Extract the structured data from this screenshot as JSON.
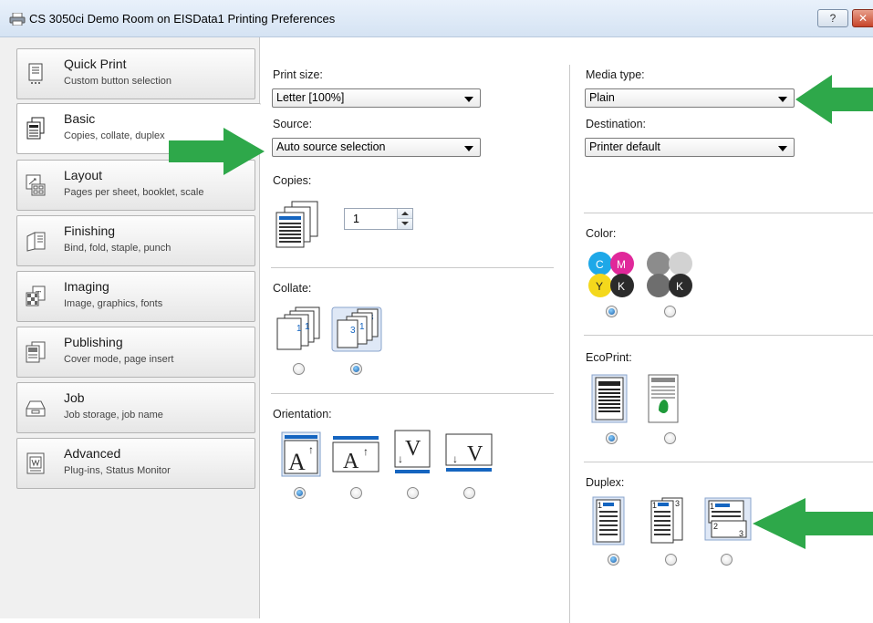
{
  "window": {
    "title": "CS 3050ci Demo Room on EISData1 Printing Preferences",
    "help_label": "?",
    "close_label": "✕"
  },
  "sidebar": {
    "items": [
      {
        "label": "Quick Print",
        "desc": "Custom button selection",
        "icon": "quick-print-icon"
      },
      {
        "label": "Basic",
        "desc": "Copies, collate, duplex",
        "icon": "basic-icon"
      },
      {
        "label": "Layout",
        "desc": "Pages per sheet, booklet, scale",
        "icon": "layout-icon"
      },
      {
        "label": "Finishing",
        "desc": "Bind, fold, staple, punch",
        "icon": "finishing-icon"
      },
      {
        "label": "Imaging",
        "desc": "Image, graphics, fonts",
        "icon": "imaging-icon"
      },
      {
        "label": "Publishing",
        "desc": "Cover mode, page insert",
        "icon": "publishing-icon"
      },
      {
        "label": "Job",
        "desc": "Job storage, job name",
        "icon": "job-icon"
      },
      {
        "label": "Advanced",
        "desc": "Plug-ins, Status Monitor",
        "icon": "advanced-icon"
      }
    ],
    "active_index": 1
  },
  "main": {
    "print_size": {
      "label": "Print size:",
      "value": "Letter  [100%]"
    },
    "source": {
      "label": "Source:",
      "value": "Auto source selection"
    },
    "copies": {
      "label": "Copies:",
      "value": "1"
    },
    "collate": {
      "label": "Collate:",
      "options": [
        "uncollated",
        "collated"
      ],
      "selected": 1
    },
    "orientation": {
      "label": "Orientation:",
      "options": [
        "portrait",
        "landscape",
        "rotated-portrait",
        "rotated-landscape"
      ],
      "selected": 0
    },
    "media_type": {
      "label": "Media type:",
      "value": "Plain"
    },
    "destination": {
      "label": "Destination:",
      "value": "Printer default"
    },
    "color": {
      "label": "Color:",
      "options": [
        "color",
        "black-and-white"
      ],
      "selected": 0,
      "cmyk_letters": [
        "C",
        "M",
        "Y",
        "K"
      ],
      "bw_letter": "K"
    },
    "ecoprint": {
      "label": "EcoPrint:",
      "options": [
        "off",
        "on"
      ],
      "selected": 0
    },
    "duplex": {
      "label": "Duplex:",
      "options": [
        "1-sided",
        "2-sided-long-edge",
        "2-sided-short-edge"
      ],
      "selected": 0
    }
  },
  "colors": {
    "accent_blue": "#1565c0",
    "arrow_green": "#2ea84a",
    "cyan": "#1ea8e8",
    "magenta": "#e0289a",
    "yellow": "#f4d81c",
    "black": "#2b2b2b"
  }
}
